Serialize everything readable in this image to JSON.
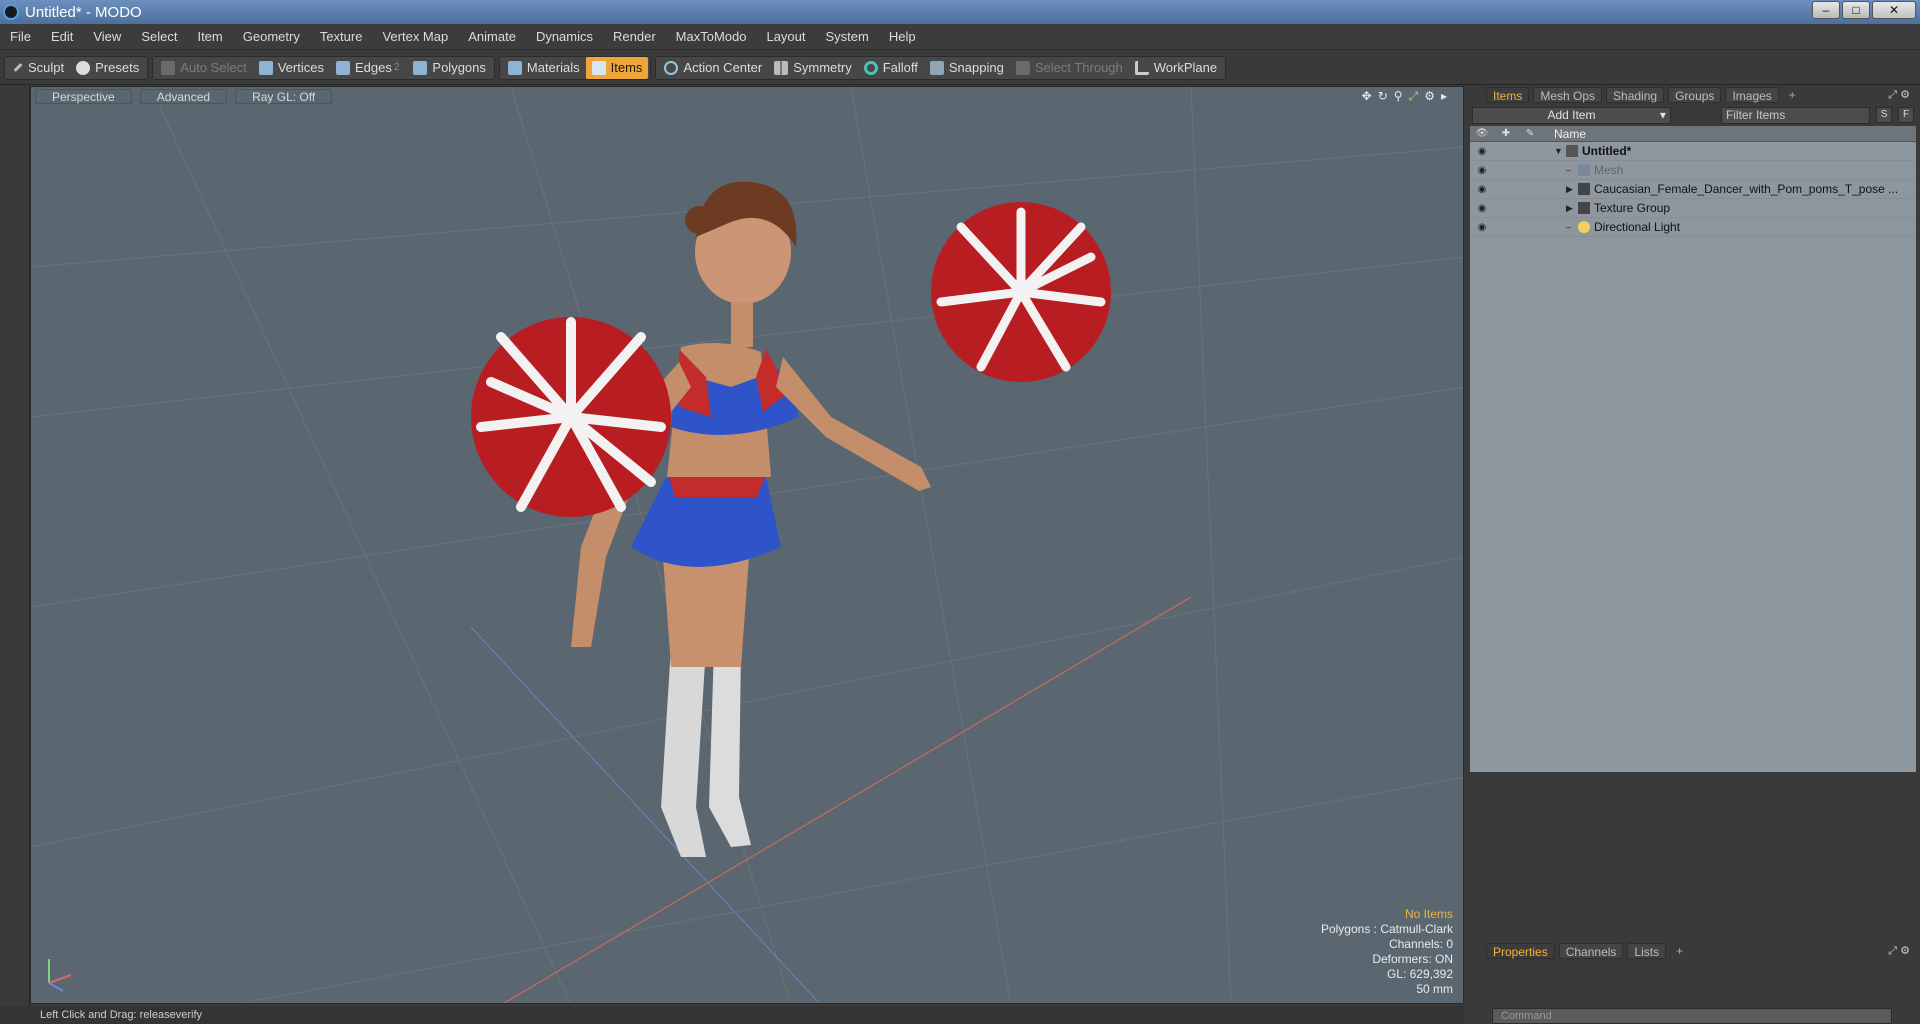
{
  "window": {
    "title": "Untitled* - MODO",
    "minimize": "–",
    "maximize": "□",
    "close": "✕"
  },
  "menu": [
    "File",
    "Edit",
    "View",
    "Select",
    "Item",
    "Geometry",
    "Texture",
    "Vertex Map",
    "Animate",
    "Dynamics",
    "Render",
    "MaxToModo",
    "Layout",
    "System",
    "Help"
  ],
  "toolbar": {
    "sculpt": "Sculpt",
    "presets": "Presets",
    "auto_select": "Auto Select",
    "vertices": "Vertices",
    "edges": "Edges",
    "edges_badge": "2",
    "polygons": "Polygons",
    "materials": "Materials",
    "items": "Items",
    "action_center": "Action Center",
    "symmetry": "Symmetry",
    "falloff": "Falloff",
    "snapping": "Snapping",
    "select_through": "Select Through",
    "workplane": "WorkPlane"
  },
  "viewport": {
    "tabs": [
      "Perspective",
      "Advanced",
      "Ray GL: Off"
    ],
    "info": {
      "selection": "No Items",
      "polygons": "Polygons : Catmull-Clark",
      "channels": "Channels: 0",
      "deformers": "Deformers: ON",
      "gl": "GL: 629,392",
      "lens": "50 mm"
    }
  },
  "status": {
    "text": "Left Click and Drag:  releaseverify"
  },
  "items_panel": {
    "tabs": [
      "Items",
      "Mesh Ops",
      "Shading",
      "Groups",
      "Images",
      "+"
    ],
    "add_item": "Add Item",
    "filter_placeholder": "Filter Items",
    "btn_s": "S",
    "btn_f": "F",
    "name_header": "Name",
    "tree": [
      {
        "name": "Untitled*",
        "indent": 0,
        "expanded": true,
        "style": "bold"
      },
      {
        "name": "Mesh",
        "indent": 1,
        "style": "dim"
      },
      {
        "name": "Caucasian_Female_Dancer_with_Pom_poms_T_pose ...",
        "indent": 1,
        "style": "normal"
      },
      {
        "name": "Texture Group",
        "indent": 1,
        "style": "normal"
      },
      {
        "name": "Directional Light",
        "indent": 1,
        "style": "normal"
      }
    ]
  },
  "props_panel": {
    "tabs": [
      "Properties",
      "Channels",
      "Lists",
      "+"
    ],
    "command_placeholder": "Command"
  },
  "colors": {
    "accent": "#f0a53b",
    "viewport_bg": "#5a6770",
    "items_bg": "#8f979e"
  }
}
